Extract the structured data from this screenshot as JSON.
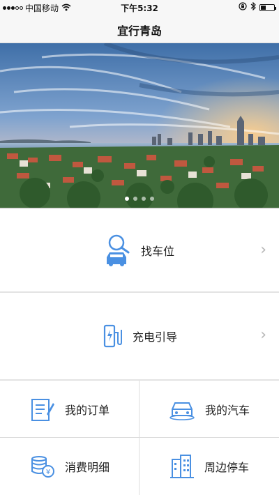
{
  "status_bar": {
    "carrier": "中国移动",
    "time": "下午5:32",
    "icons": [
      "signal-icon",
      "wifi-icon",
      "lock-rotation-icon",
      "bluetooth-icon",
      "battery-icon"
    ]
  },
  "nav": {
    "title": "宜行青岛"
  },
  "banner": {
    "pages": 4,
    "active_page": 1
  },
  "menu": [
    {
      "label": "找车位",
      "icon": "find-parking-icon"
    },
    {
      "label": "充电引导",
      "icon": "charging-station-icon"
    }
  ],
  "grid": [
    {
      "label": "我的订单",
      "icon": "order-icon"
    },
    {
      "label": "我的汽车",
      "icon": "car-icon"
    },
    {
      "label": "消费明细",
      "icon": "consumption-icon"
    },
    {
      "label": "周边停车",
      "icon": "nearby-parking-icon"
    }
  ],
  "colors": {
    "accent": "#4a90e2",
    "chevron": "#b5b5b5"
  }
}
